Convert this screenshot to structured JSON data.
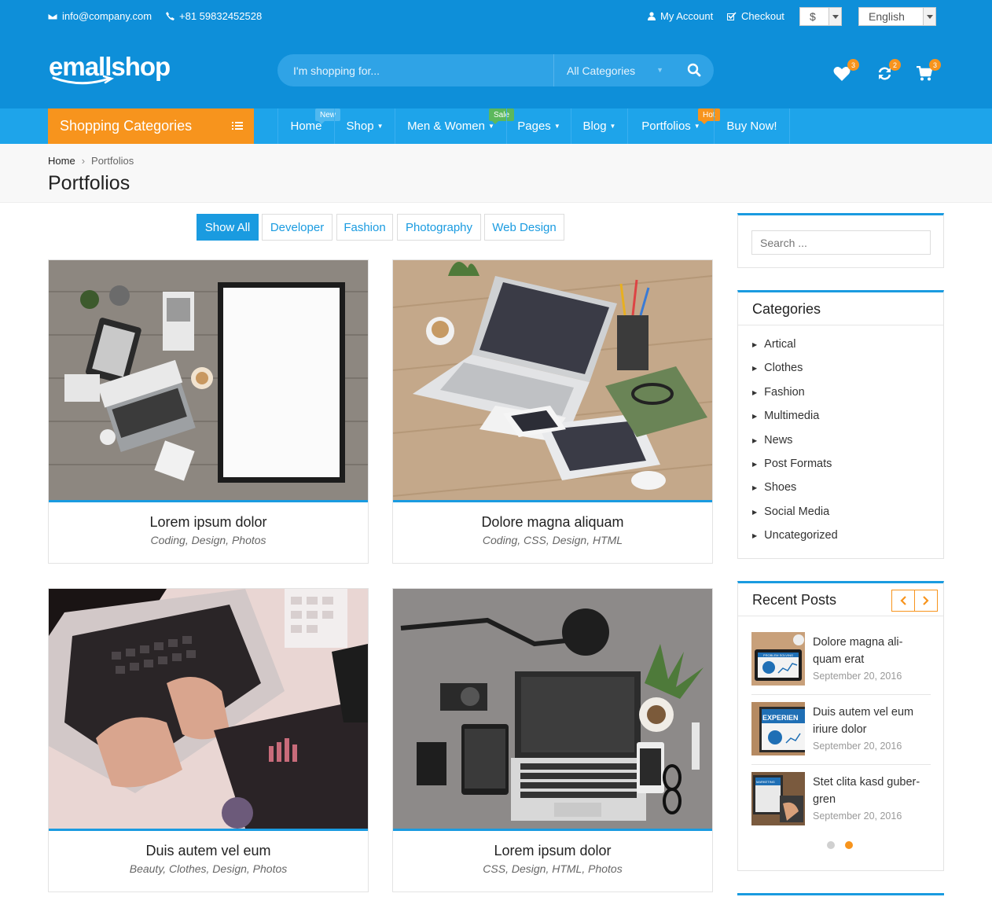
{
  "topbar": {
    "email": "info@company.com",
    "phone": "+81 59832452528",
    "my_account": "My Account",
    "checkout": "Checkout",
    "currency": "$",
    "language": "English"
  },
  "header": {
    "logo": "emallshop",
    "search_placeholder": "I'm shopping for...",
    "search_category": "All Categories",
    "wishlist_count": "3",
    "compare_count": "2",
    "cart_count": "3"
  },
  "nav": {
    "shopping_categories": "Shopping Categories",
    "items": [
      {
        "label": "Home",
        "tag": "New"
      },
      {
        "label": "Shop",
        "tag": ""
      },
      {
        "label": "Men & Women",
        "tag": "Sale"
      },
      {
        "label": "Pages",
        "tag": ""
      },
      {
        "label": "Blog",
        "tag": ""
      },
      {
        "label": "Portfolios",
        "tag": "Hot"
      },
      {
        "label": "Buy Now!",
        "tag": ""
      }
    ]
  },
  "breadcrumb": {
    "home": "Home",
    "current": "Portfolios",
    "page_title": "Portfolios"
  },
  "filters": [
    "Show All",
    "Developer",
    "Fashion",
    "Photography",
    "Web Design"
  ],
  "portfolio": [
    {
      "title": "Lorem ipsum dolor",
      "tags": "Coding, Design, Photos"
    },
    {
      "title": "Dolore magna aliquam",
      "tags": "Coding, CSS, Design, HTML"
    },
    {
      "title": "Duis autem vel eum",
      "tags": "Beauty, Clothes, Design, Photos"
    },
    {
      "title": "Lorem ipsum dolor",
      "tags": "CSS, Design, HTML, Photos"
    }
  ],
  "sidebar": {
    "search_placeholder": "Search ...",
    "categories_title": "Categories",
    "categories": [
      "Artical",
      "Clothes",
      "Fashion",
      "Multimedia",
      "News",
      "Post Formats",
      "Shoes",
      "Social Media",
      "Uncategorized"
    ],
    "recent_title": "Recent Posts",
    "recent_posts": [
      {
        "title": "Dolore magna ali-quam erat",
        "date": "September 20, 2016",
        "thumb_text": "PROBLEM SOLVING"
      },
      {
        "title": "Duis autem vel eum iriure dolor",
        "date": "September 20, 2016",
        "thumb_text": "EXPERIEN"
      },
      {
        "title": "Stet clita kasd guber-gren",
        "date": "September 20, 2016",
        "thumb_text": "MARKETING"
      }
    ]
  },
  "colors": {
    "header_blue": "#0e8fd9",
    "nav_blue": "#1ea4ea",
    "accent_orange": "#f7941d",
    "link_blue": "#1a9be0"
  }
}
